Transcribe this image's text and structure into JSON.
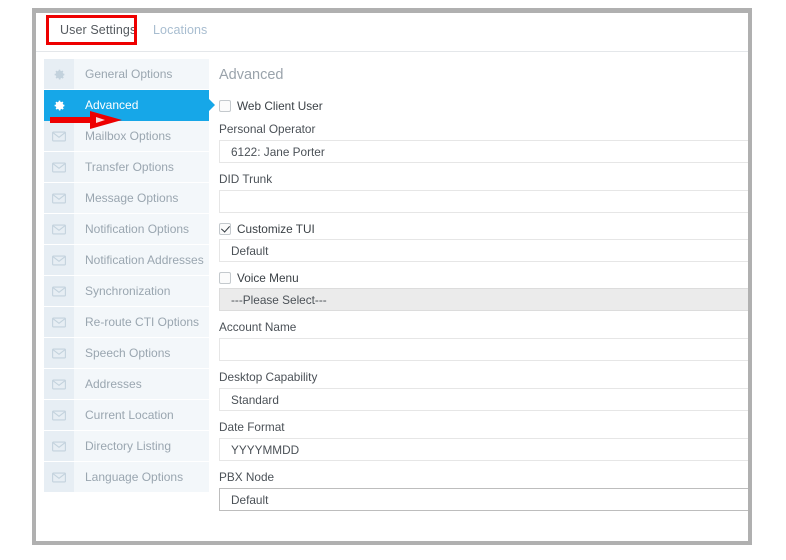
{
  "tabs": [
    {
      "label": "User Settings",
      "active": true
    },
    {
      "label": "Locations",
      "active": false
    }
  ],
  "sidebar": {
    "items": [
      {
        "label": "General Options",
        "icon": "gear-icon",
        "active": false
      },
      {
        "label": "Advanced",
        "icon": "gear-icon",
        "active": true
      },
      {
        "label": "Mailbox Options",
        "icon": "envelope-icon",
        "active": false
      },
      {
        "label": "Transfer Options",
        "icon": "envelope-icon",
        "active": false
      },
      {
        "label": "Message Options",
        "icon": "envelope-icon",
        "active": false
      },
      {
        "label": "Notification Options",
        "icon": "envelope-icon",
        "active": false
      },
      {
        "label": "Notification Addresses",
        "icon": "envelope-icon",
        "active": false
      },
      {
        "label": "Synchronization",
        "icon": "envelope-icon",
        "active": false
      },
      {
        "label": "Re-route CTI Options",
        "icon": "envelope-icon",
        "active": false
      },
      {
        "label": "Speech Options",
        "icon": "envelope-icon",
        "active": false
      },
      {
        "label": "Addresses",
        "icon": "envelope-icon",
        "active": false
      },
      {
        "label": "Current Location",
        "icon": "envelope-icon",
        "active": false
      },
      {
        "label": "Directory Listing",
        "icon": "envelope-icon",
        "active": false
      },
      {
        "label": "Language Options",
        "icon": "envelope-icon",
        "active": false
      }
    ]
  },
  "main": {
    "title": "Advanced",
    "web_client_user": {
      "label": "Web Client User",
      "checked": false
    },
    "personal_operator": {
      "label": "Personal Operator",
      "value": "6122: Jane Porter"
    },
    "did_trunk": {
      "label": "DID Trunk",
      "value": ""
    },
    "customize_tui": {
      "label": "Customize TUI",
      "checked": true,
      "value": "Default"
    },
    "voice_menu": {
      "label": "Voice Menu",
      "checked": false,
      "value": "---Please Select---"
    },
    "account_name": {
      "label": "Account Name",
      "value": ""
    },
    "desktop_capability": {
      "label": "Desktop Capability",
      "value": "Standard"
    },
    "date_format": {
      "label": "Date Format",
      "value": "YYYYMMDD"
    },
    "pbx_node": {
      "label": "PBX Node",
      "value": "Default"
    }
  },
  "annotations": {
    "highlight_target": "User Settings",
    "arrow_target": "Advanced",
    "color": "#ee0000"
  },
  "colors": {
    "accent": "#16a7e8",
    "sidebar_bg": "#f3f7fa",
    "label": "#4b5157",
    "muted": "#9aa6b0"
  }
}
